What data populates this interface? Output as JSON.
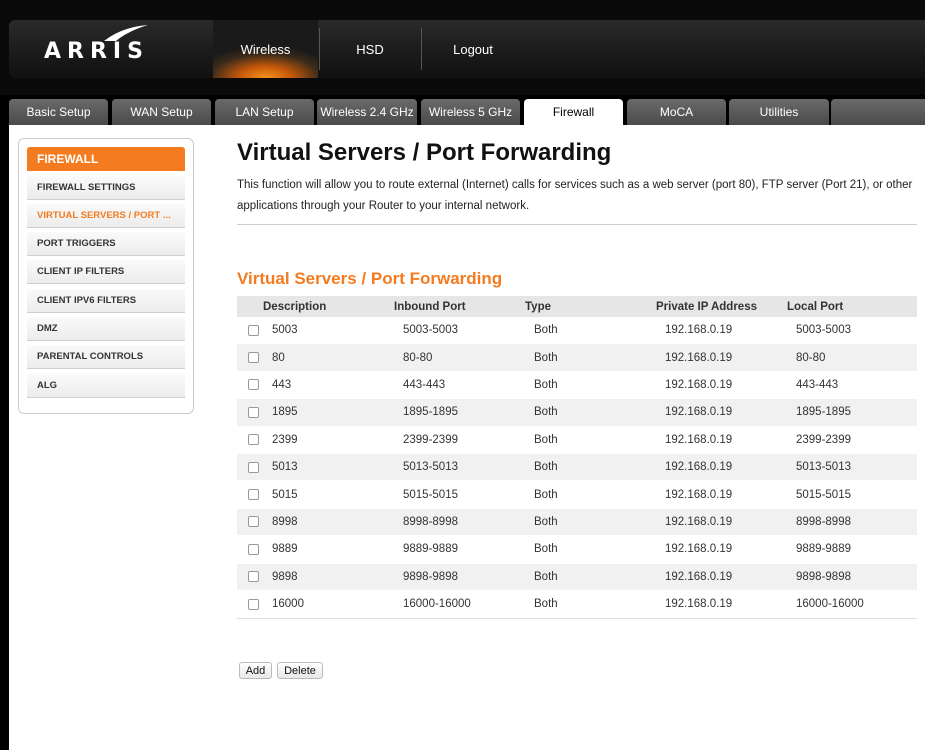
{
  "brand": "ARRIS",
  "colors": {
    "accent": "#f47b20",
    "header_bg": "#1a1a1a",
    "tab_bg": "#5a5a5a"
  },
  "top_nav": [
    {
      "label": "Wireless",
      "active": true
    },
    {
      "label": "HSD",
      "active": false
    },
    {
      "label": "Logout",
      "active": false
    }
  ],
  "tabs": [
    {
      "label": "Basic Setup",
      "active": false
    },
    {
      "label": "WAN Setup",
      "active": false
    },
    {
      "label": "LAN Setup",
      "active": false
    },
    {
      "label": "Wireless 2.4 GHz",
      "active": false
    },
    {
      "label": "Wireless 5 GHz",
      "active": false
    },
    {
      "label": "Firewall",
      "active": true
    },
    {
      "label": "MoCA",
      "active": false
    },
    {
      "label": "Utilities",
      "active": false
    }
  ],
  "sidebar": {
    "header": "FIREWALL",
    "items": [
      {
        "label": "FIREWALL SETTINGS",
        "active": false
      },
      {
        "label": "VIRTUAL SERVERS / PORT ...",
        "active": true
      },
      {
        "label": "PORT TRIGGERS",
        "active": false
      },
      {
        "label": "CLIENT IP FILTERS",
        "active": false
      },
      {
        "label": "CLIENT IPV6 FILTERS",
        "active": false
      },
      {
        "label": "DMZ",
        "active": false
      },
      {
        "label": "PARENTAL CONTROLS",
        "active": false
      },
      {
        "label": "ALG",
        "active": false
      }
    ]
  },
  "main": {
    "title": "Virtual Servers / Port Forwarding",
    "description": "This function will allow you to route external (Internet) calls for services such as a web server (port 80), FTP server (Port 21), or other applications through your Router to your internal network.",
    "section_title": "Virtual Servers / Port Forwarding",
    "table": {
      "headers": [
        "Description",
        "Inbound Port",
        "Type",
        "Private IP Address",
        "Local Port"
      ],
      "rows": [
        {
          "description": "5003",
          "inbound_port": "5003-5003",
          "type": "Both",
          "private_ip": "192.168.0.19",
          "local_port": "5003-5003"
        },
        {
          "description": "80",
          "inbound_port": "80-80",
          "type": "Both",
          "private_ip": "192.168.0.19",
          "local_port": "80-80"
        },
        {
          "description": "443",
          "inbound_port": "443-443",
          "type": "Both",
          "private_ip": "192.168.0.19",
          "local_port": "443-443"
        },
        {
          "description": "1895",
          "inbound_port": "1895-1895",
          "type": "Both",
          "private_ip": "192.168.0.19",
          "local_port": "1895-1895"
        },
        {
          "description": "2399",
          "inbound_port": "2399-2399",
          "type": "Both",
          "private_ip": "192.168.0.19",
          "local_port": "2399-2399"
        },
        {
          "description": "5013",
          "inbound_port": "5013-5013",
          "type": "Both",
          "private_ip": "192.168.0.19",
          "local_port": "5013-5013"
        },
        {
          "description": "5015",
          "inbound_port": "5015-5015",
          "type": "Both",
          "private_ip": "192.168.0.19",
          "local_port": "5015-5015"
        },
        {
          "description": "8998",
          "inbound_port": "8998-8998",
          "type": "Both",
          "private_ip": "192.168.0.19",
          "local_port": "8998-8998"
        },
        {
          "description": "9889",
          "inbound_port": "9889-9889",
          "type": "Both",
          "private_ip": "192.168.0.19",
          "local_port": "9889-9889"
        },
        {
          "description": "9898",
          "inbound_port": "9898-9898",
          "type": "Both",
          "private_ip": "192.168.0.19",
          "local_port": "9898-9898"
        },
        {
          "description": "16000",
          "inbound_port": "16000-16000",
          "type": "Both",
          "private_ip": "192.168.0.19",
          "local_port": "16000-16000"
        }
      ]
    },
    "buttons": {
      "add": "Add",
      "delete": "Delete"
    }
  }
}
